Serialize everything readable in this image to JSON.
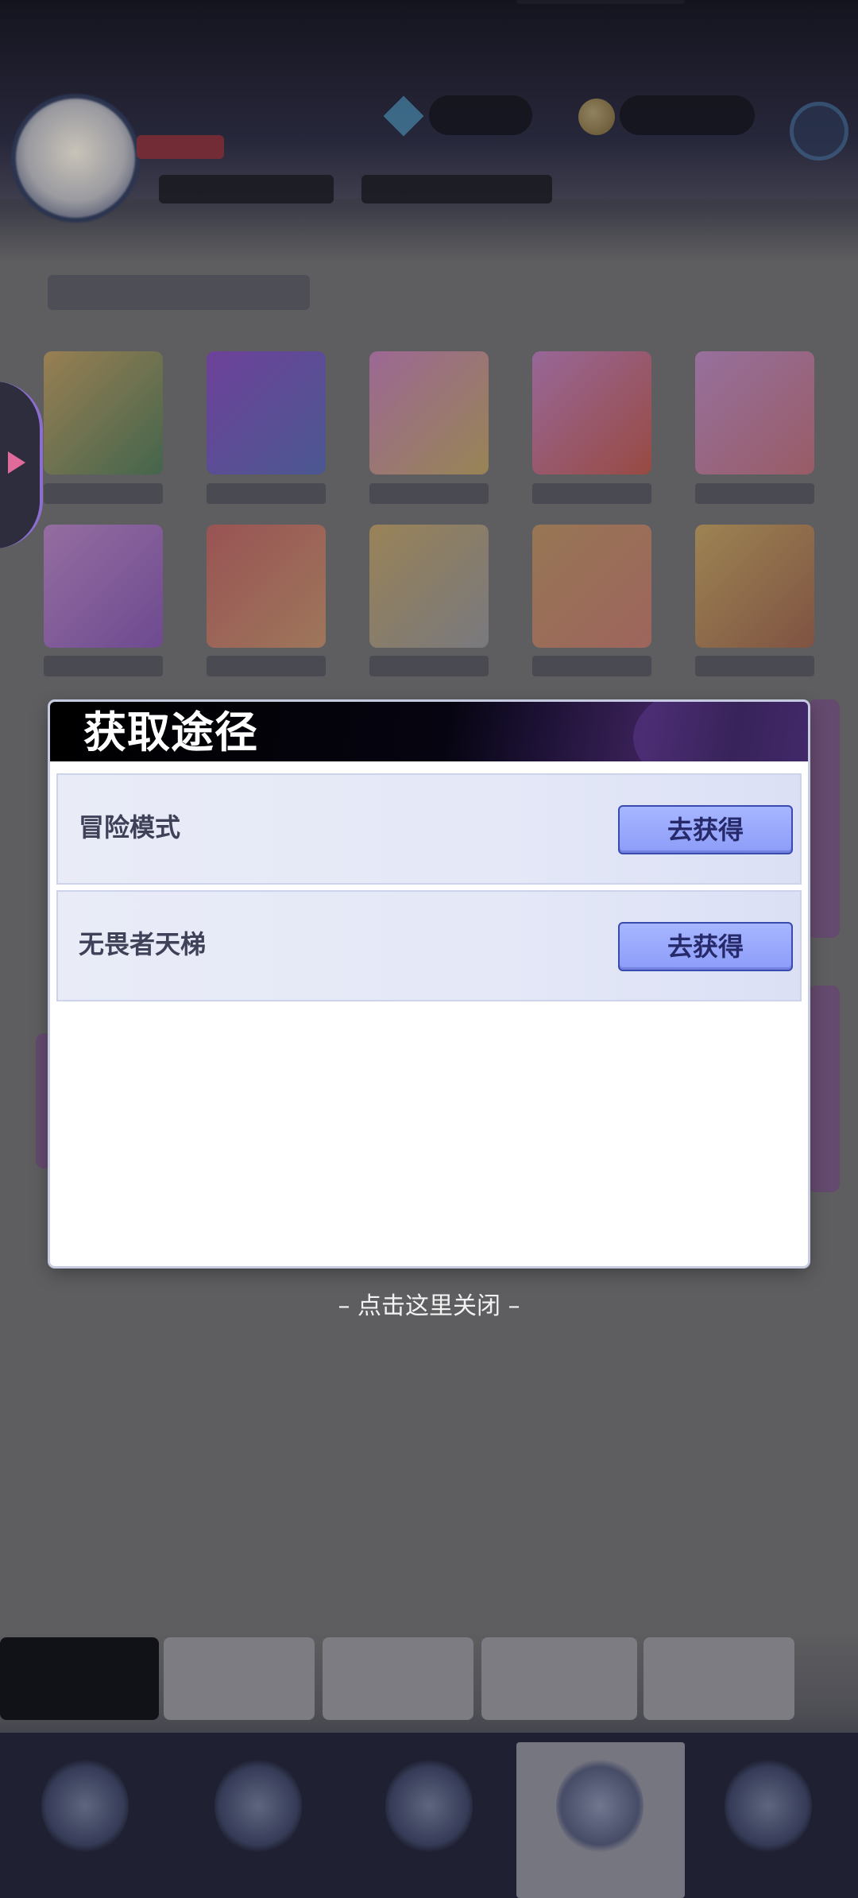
{
  "modal": {
    "title": "获取途径",
    "routes": [
      {
        "name": "冒险模式",
        "button_label": "去获得"
      },
      {
        "name": "无畏者天梯",
        "button_label": "去获得"
      }
    ]
  },
  "close_hint": "– 点击这里关闭 –",
  "colors": {
    "overlay": "#5e5e60",
    "modal_header": "#000000",
    "row_bg": "#e6e9f7",
    "button_bg": "#9aa8fc",
    "button_text": "#262a6a"
  },
  "icons": [
    "avatar",
    "coin-icon",
    "gem-icon",
    "settings-icon",
    "side-arrow-icon"
  ]
}
